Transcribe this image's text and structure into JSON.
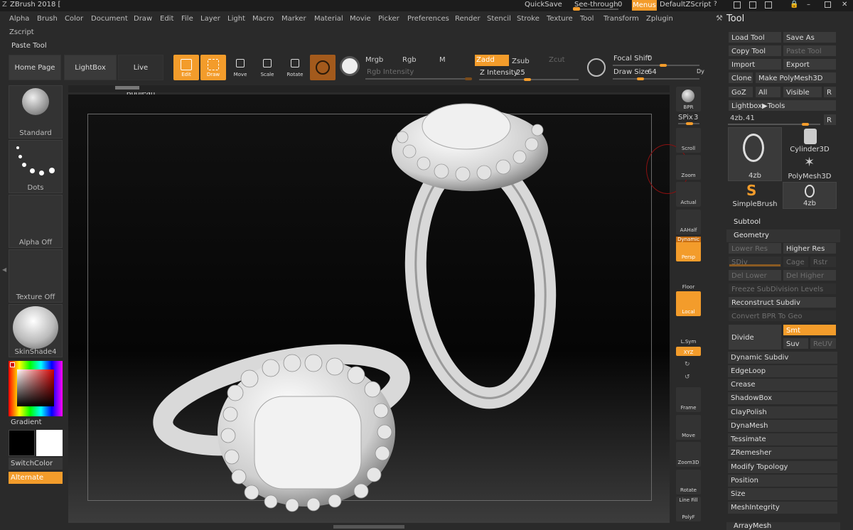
{
  "app": {
    "title": "ZBrush 2018 [",
    "quicksave": "QuickSave",
    "see_through_label": "See-through",
    "see_through_value": "0",
    "menus": "Menus",
    "default_zscript": "DefaultZScript"
  },
  "menubar": [
    "Alpha",
    "Brush",
    "Color",
    "Document",
    "Draw",
    "Edit",
    "File",
    "Layer",
    "Light",
    "Macro",
    "Marker",
    "Material",
    "Movie",
    "Picker",
    "Preferences",
    "Render",
    "Stencil",
    "Stroke",
    "Texture",
    "Tool",
    "Transform",
    "Zplugin"
  ],
  "zscript": "Zscript",
  "paste_tool": "Paste Tool",
  "shelf": {
    "home": "Home Page",
    "lightbox": "LightBox",
    "live_boolean": "Live Boolean",
    "edit": "Edit",
    "draw": "Draw",
    "move": "Move",
    "scale": "Scale",
    "rotate": "Rotate",
    "mrgb": "Mrgb",
    "rgb": "Rgb",
    "m": "M",
    "zadd": "Zadd",
    "zsub": "Zsub",
    "zcut": "Zcut",
    "rgb_intensity": "Rgb Intensity",
    "z_intensity_label": "Z Intensity",
    "z_intensity_value": "25",
    "focal_shift_label": "Focal Shift",
    "focal_shift_value": "0",
    "draw_size_label": "Draw Size",
    "draw_size_value": "64",
    "dy": "Dy"
  },
  "left_tray": {
    "standard": "Standard",
    "dots": "Dots",
    "alpha_off": "Alpha Off",
    "texture_off": "Texture Off",
    "skinshade": "SkinShade4",
    "gradient": "Gradient",
    "switchcolor": "SwitchColor",
    "alternate": "Alternate"
  },
  "right_shelf": {
    "bpr": "BPR",
    "spix_label": "SPix",
    "spix_value": "3",
    "scroll": "Scroll",
    "zoom": "Zoom",
    "actual": "Actual",
    "aahalf": "AAHalf",
    "dynamic": "Dynamic",
    "persp": "Persp",
    "floor": "Floor",
    "local": "Local",
    "lsym": "L.Sym",
    "xyz": "XYZ",
    "frame": "Frame",
    "move": "Move",
    "zoom3d": "Zoom3D",
    "rotate": "Rotate",
    "line_fill": "Line Fill",
    "polyf": "PolyF"
  },
  "tool_panel": {
    "title": "Tool",
    "load_tool": "Load Tool",
    "save_as": "Save As",
    "copy_tool": "Copy Tool",
    "paste_tool": "Paste Tool",
    "import": "Import",
    "export": "Export",
    "clone": "Clone",
    "make_polymesh": "Make PolyMesh3D",
    "goz": "GoZ",
    "all": "All",
    "visible": "Visible",
    "r": "R",
    "lightbox_tools": "Lightbox▶Tools",
    "current_tool_label": "4zb.",
    "current_tool_value": "41",
    "thumbs": [
      "4zb",
      "Cylinder3D",
      "PolyMesh3D",
      "SimpleBrush",
      "4zb"
    ],
    "subtool": "Subtool",
    "geometry": "Geometry",
    "lower_res": "Lower Res",
    "higher_res": "Higher Res",
    "sdiv": "SDiv",
    "cage": "Cage",
    "rstr": "Rstr",
    "del_lower": "Del Lower",
    "del_higher": "Del Higher",
    "freeze": "Freeze SubDivision Levels",
    "reconstruct": "Reconstruct Subdiv",
    "convert_bpr": "Convert BPR To Geo",
    "divide": "Divide",
    "smt": "Smt",
    "suv": "Suv",
    "reuv": "ReUV",
    "items": [
      "Dynamic Subdiv",
      "EdgeLoop",
      "Crease",
      "ShadowBox",
      "ClayPolish",
      "DynaMesh",
      "Tessimate",
      "ZRemesher",
      "Modify Topology",
      "Position",
      "Size",
      "MeshIntegrity"
    ],
    "arraymesh": "ArrayMesh"
  },
  "colors": {
    "accent": "#f39c2b"
  }
}
